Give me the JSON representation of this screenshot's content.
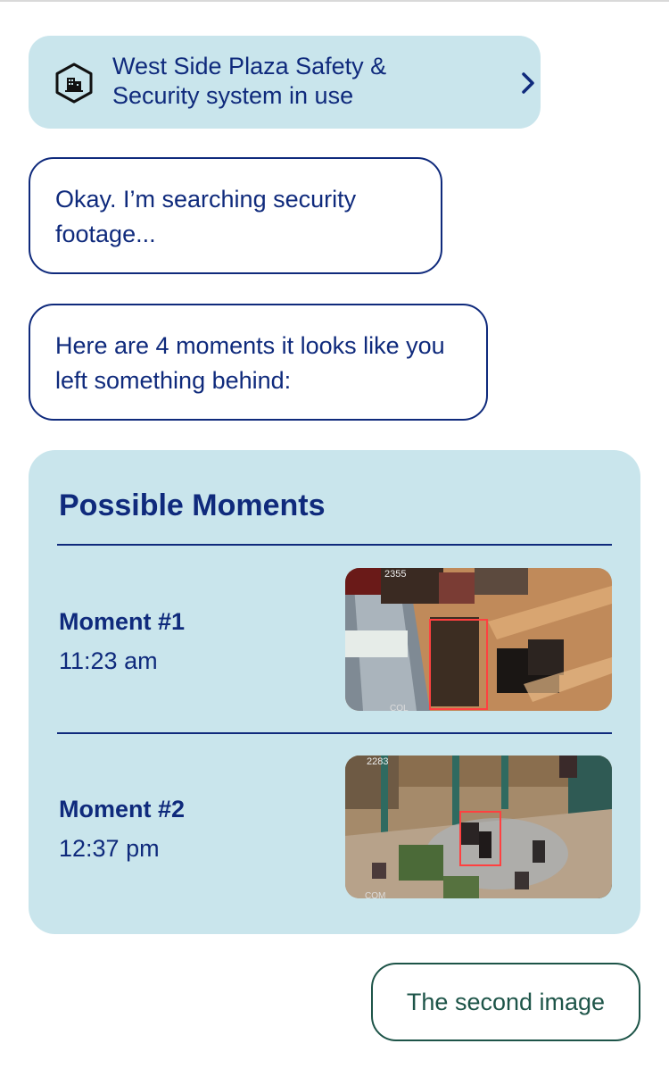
{
  "banner": {
    "icon": "building-hexagon-icon",
    "text": "West Side Plaza Safety & Security system in use",
    "action_icon": "chevron-right-icon"
  },
  "messages": [
    {
      "role": "assistant",
      "text": "Okay. I’m searching security footage..."
    },
    {
      "role": "assistant",
      "text": "Here are 4 moments it looks like you left something behind:"
    }
  ],
  "moments_card": {
    "title": "Possible Moments",
    "items": [
      {
        "name": "Moment #1",
        "time": "11:23 am",
        "thumbnail_overlay_text": "2355",
        "thumbnail_watermark": "COL"
      },
      {
        "name": "Moment #2",
        "time": "12:37 pm",
        "thumbnail_overlay_text": "2283",
        "thumbnail_watermark": "COM"
      }
    ]
  },
  "user_reply": {
    "text": "The second image"
  },
  "colors": {
    "navy": "#0f2a7c",
    "card_bg": "#c9e5ec",
    "reply_border": "#1d5448",
    "highlight_box": "#ff4040"
  }
}
